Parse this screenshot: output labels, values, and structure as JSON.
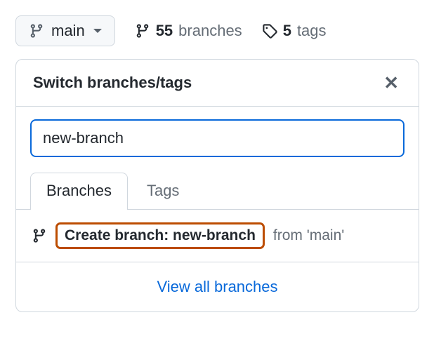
{
  "branchSelector": {
    "current": "main"
  },
  "stats": {
    "branches": {
      "count": "55",
      "label": "branches"
    },
    "tags": {
      "count": "5",
      "label": "tags"
    }
  },
  "popover": {
    "title": "Switch branches/tags",
    "searchValue": "new-branch",
    "tabs": {
      "branches": "Branches",
      "tags": "Tags"
    },
    "createAction": {
      "prefix": "Create branch: ",
      "name": "new-branch",
      "from": "from 'main'"
    },
    "viewAll": "View all branches"
  }
}
